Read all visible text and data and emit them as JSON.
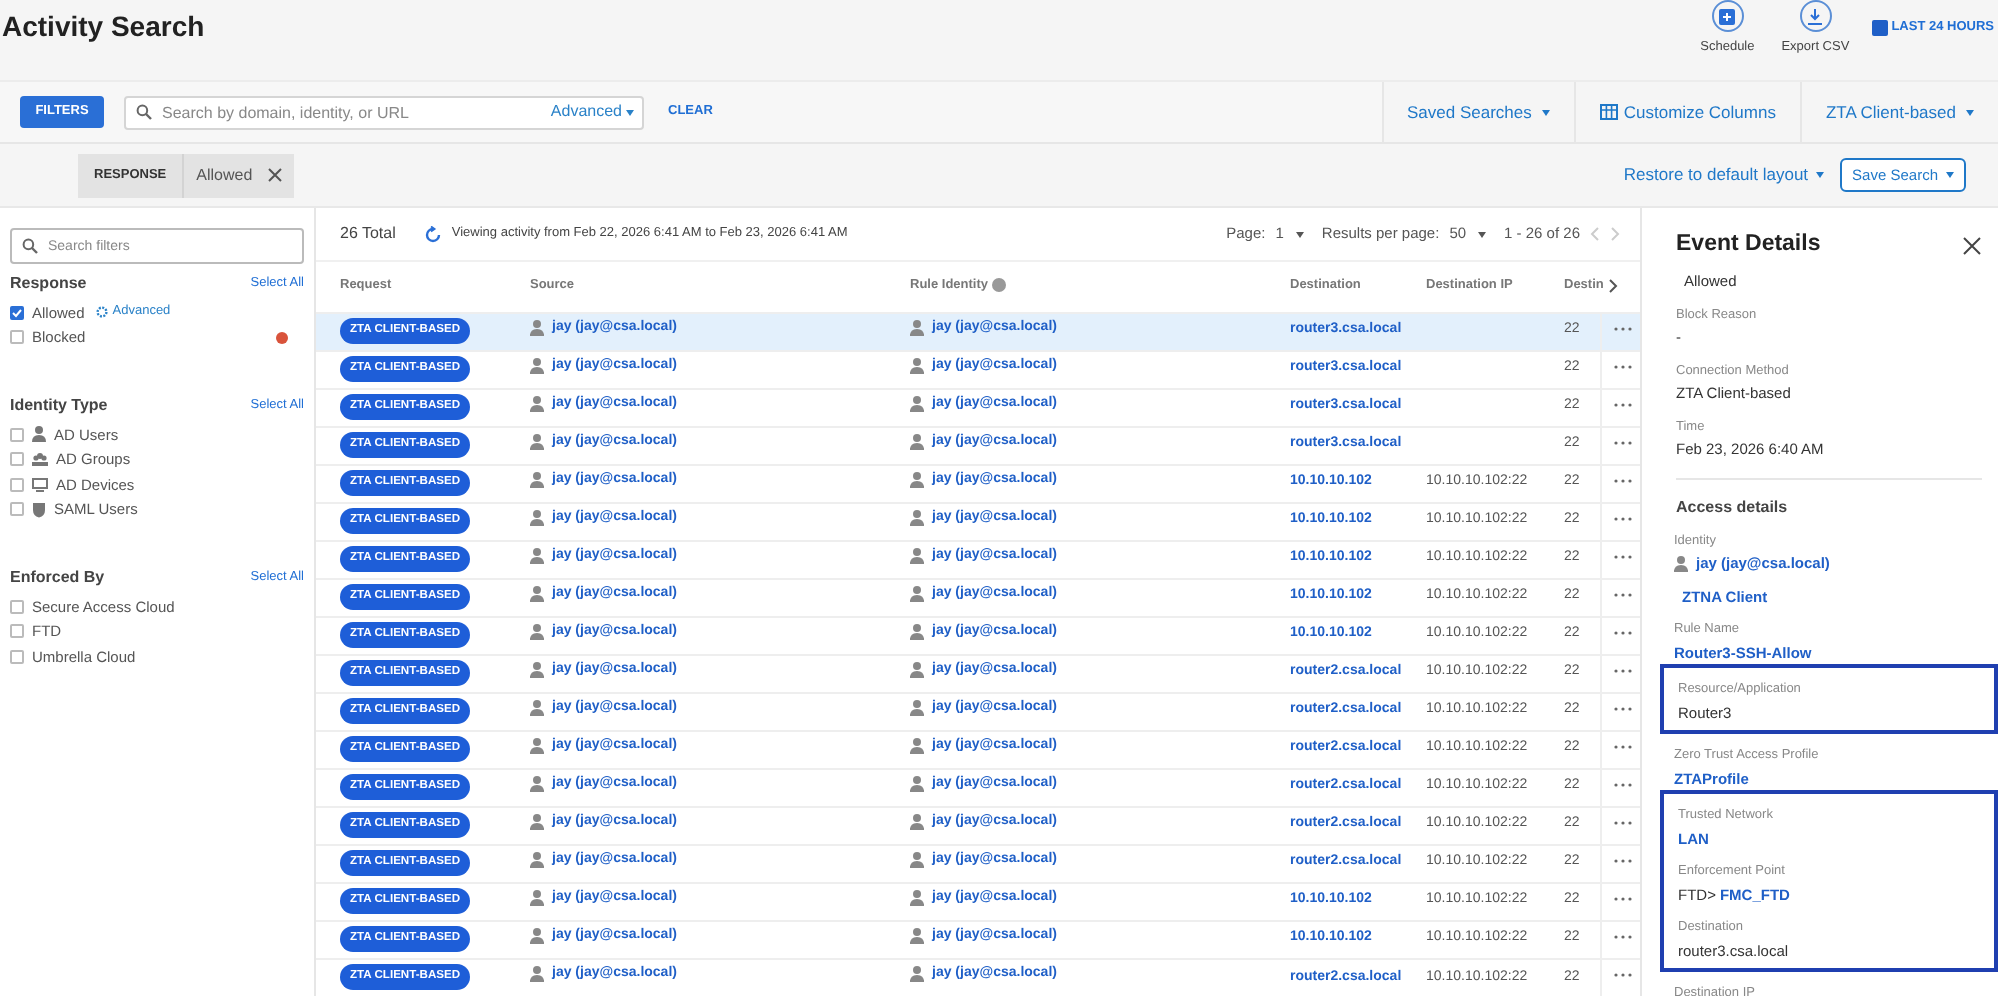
{
  "header": {
    "title": "Activity Search",
    "actions": [
      {
        "label": "Schedule",
        "kind": "schedule"
      },
      {
        "label": "Export CSV",
        "kind": "export"
      }
    ],
    "time_range": "LAST 24 HOURS"
  },
  "toolbar": {
    "filters_button": "FILTERS",
    "search": {
      "placeholder": "Search by domain, identity, or URL",
      "advanced": "Advanced"
    },
    "clear": "CLEAR",
    "right": [
      {
        "label": "Saved Searches",
        "kind": "dropdown"
      },
      {
        "label": "Customize Columns",
        "kind": "columns"
      },
      {
        "label": "ZTA Client-based",
        "kind": "dropdown"
      }
    ]
  },
  "chips": [
    {
      "key": "RESPONSE",
      "value": "Allowed"
    }
  ],
  "layout_actions": {
    "restore": "Restore to default layout",
    "save": "Save Search"
  },
  "sidebar": {
    "search_placeholder": "Search filters",
    "groups": [
      {
        "title": "Response",
        "select_all": "Select All",
        "items": [
          {
            "label": "Allowed",
            "checked": true,
            "link": "Advanced"
          },
          {
            "label": "Blocked",
            "checked": false,
            "color": "#d9533b"
          }
        ]
      },
      {
        "title": "Identity Type",
        "select_all": "Select All",
        "items": [
          {
            "label": "AD Users",
            "checked": false,
            "kind": "user"
          },
          {
            "label": "AD Groups",
            "checked": false,
            "kind": "group"
          },
          {
            "label": "AD Devices",
            "checked": false,
            "kind": "device"
          },
          {
            "label": "SAML Users",
            "checked": false,
            "kind": "saml"
          }
        ]
      },
      {
        "title": "Enforced By",
        "select_all": "Select All",
        "items": [
          {
            "label": "Secure Access Cloud",
            "checked": false
          },
          {
            "label": "FTD",
            "checked": false
          },
          {
            "label": "Umbrella Cloud",
            "checked": false
          }
        ]
      }
    ]
  },
  "table": {
    "total": "26 Total",
    "range_text": "Viewing activity from Feb 22, 2026 6:41 AM to Feb 23, 2026 6:41 AM",
    "page_label": "Page:",
    "page": "1",
    "per_page_label": "Results per page:",
    "per_page": "50",
    "count": "1 - 26 of 26",
    "columns": [
      "Request",
      "Source",
      "Rule Identity",
      "Destination",
      "Destination IP",
      "Destin"
    ],
    "rows": [
      {
        "selected": true,
        "request": "ZTA CLIENT-BASED",
        "source": "jay (jay@csa.local)",
        "rule_identity": "jay (jay@csa.local)",
        "destination": "router3.csa.local",
        "port": "22"
      },
      {
        "selected": false,
        "request": "ZTA CLIENT-BASED",
        "source": "jay (jay@csa.local)",
        "rule_identity": "jay (jay@csa.local)",
        "destination": "router3.csa.local",
        "port": "22"
      },
      {
        "selected": false,
        "request": "ZTA CLIENT-BASED",
        "source": "jay (jay@csa.local)",
        "rule_identity": "jay (jay@csa.local)",
        "destination": "router3.csa.local",
        "port": "22"
      },
      {
        "selected": false,
        "request": "ZTA CLIENT-BASED",
        "source": "jay (jay@csa.local)",
        "rule_identity": "jay (jay@csa.local)",
        "destination": "router3.csa.local",
        "port": "22"
      },
      {
        "selected": false,
        "request": "ZTA CLIENT-BASED",
        "source": "jay (jay@csa.local)",
        "rule_identity": "jay (jay@csa.local)",
        "destination": "10.10.10.102",
        "destination_ip": "10.10.10.102:22",
        "port": "22"
      },
      {
        "selected": false,
        "request": "ZTA CLIENT-BASED",
        "source": "jay (jay@csa.local)",
        "rule_identity": "jay (jay@csa.local)",
        "destination": "10.10.10.102",
        "destination_ip": "10.10.10.102:22",
        "port": "22"
      },
      {
        "selected": false,
        "request": "ZTA CLIENT-BASED",
        "source": "jay (jay@csa.local)",
        "rule_identity": "jay (jay@csa.local)",
        "destination": "10.10.10.102",
        "destination_ip": "10.10.10.102:22",
        "port": "22"
      },
      {
        "selected": false,
        "request": "ZTA CLIENT-BASED",
        "source": "jay (jay@csa.local)",
        "rule_identity": "jay (jay@csa.local)",
        "destination": "10.10.10.102",
        "destination_ip": "10.10.10.102:22",
        "port": "22"
      },
      {
        "selected": false,
        "request": "ZTA CLIENT-BASED",
        "source": "jay (jay@csa.local)",
        "rule_identity": "jay (jay@csa.local)",
        "destination": "10.10.10.102",
        "destination_ip": "10.10.10.102:22",
        "port": "22"
      },
      {
        "selected": false,
        "request": "ZTA CLIENT-BASED",
        "source": "jay (jay@csa.local)",
        "rule_identity": "jay (jay@csa.local)",
        "destination": "router2.csa.local",
        "destination_ip": "10.10.10.102:22",
        "port": "22"
      },
      {
        "selected": false,
        "request": "ZTA CLIENT-BASED",
        "source": "jay (jay@csa.local)",
        "rule_identity": "jay (jay@csa.local)",
        "destination": "router2.csa.local",
        "destination_ip": "10.10.10.102:22",
        "port": "22"
      },
      {
        "selected": false,
        "request": "ZTA CLIENT-BASED",
        "source": "jay (jay@csa.local)",
        "rule_identity": "jay (jay@csa.local)",
        "destination": "router2.csa.local",
        "destination_ip": "10.10.10.102:22",
        "port": "22"
      },
      {
        "selected": false,
        "request": "ZTA CLIENT-BASED",
        "source": "jay (jay@csa.local)",
        "rule_identity": "jay (jay@csa.local)",
        "destination": "router2.csa.local",
        "destination_ip": "10.10.10.102:22",
        "port": "22"
      },
      {
        "selected": false,
        "request": "ZTA CLIENT-BASED",
        "source": "jay (jay@csa.local)",
        "rule_identity": "jay (jay@csa.local)",
        "destination": "router2.csa.local",
        "destination_ip": "10.10.10.102:22",
        "port": "22"
      },
      {
        "selected": false,
        "request": "ZTA CLIENT-BASED",
        "source": "jay (jay@csa.local)",
        "rule_identity": "jay (jay@csa.local)",
        "destination": "router2.csa.local",
        "destination_ip": "10.10.10.102:22",
        "port": "22"
      },
      {
        "selected": false,
        "request": "ZTA CLIENT-BASED",
        "source": "jay (jay@csa.local)",
        "rule_identity": "jay (jay@csa.local)",
        "destination": "10.10.10.102",
        "destination_ip": "10.10.10.102:22",
        "port": "22"
      },
      {
        "selected": false,
        "request": "ZTA CLIENT-BASED",
        "source": "jay (jay@csa.local)",
        "rule_identity": "jay (jay@csa.local)",
        "destination": "10.10.10.102",
        "destination_ip": "10.10.10.102:22",
        "port": "22"
      },
      {
        "selected": false,
        "request": "ZTA CLIENT-BASED",
        "source": "jay (jay@csa.local)",
        "rule_identity": "jay (jay@csa.local)",
        "destination": "router2.csa.local",
        "destination_ip": "10.10.10.102:22",
        "port": "22"
      }
    ]
  },
  "details": {
    "title": "Event Details",
    "status": "Allowed",
    "fields": [
      {
        "label": "Block Reason",
        "value": "-"
      },
      {
        "label": "Connection Method",
        "value": "ZTA Client-based"
      },
      {
        "label": "Time",
        "value": "Feb 23, 2026 6:40 AM"
      }
    ],
    "access_title": "Access details",
    "access_groups": [
      {
        "outlined": false,
        "fields": [
          {
            "label": "Identity",
            "parts": [
              {
                "text": "jay (jay@csa.local)",
                "kind": "user"
              }
            ]
          },
          {
            "parts": [
              {
                "text": "ZTNA Client",
                "kind": "link"
              }
            ]
          },
          {
            "label": "Rule Name",
            "parts": [
              {
                "text": "Router3-SSH-Allow",
                "kind": "link"
              }
            ]
          }
        ]
      },
      {
        "outlined": true,
        "fields": [
          {
            "label": "Resource/Application",
            "parts": [
              {
                "text": "Router3",
                "kind": "text"
              }
            ]
          }
        ]
      },
      {
        "outlined": false,
        "fields": [
          {
            "label": "Zero Trust Access Profile",
            "parts": [
              {
                "text": "ZTAProfile",
                "kind": "link"
              }
            ]
          }
        ]
      },
      {
        "outlined": true,
        "fields": [
          {
            "label": "Trusted Network",
            "parts": [
              {
                "text": "LAN",
                "kind": "link"
              }
            ]
          },
          {
            "label": "Enforcement Point",
            "parts": [
              {
                "text": "FTD>",
                "kind": "text"
              },
              {
                "text": "FMC_FTD",
                "kind": "link"
              }
            ]
          },
          {
            "label": "Destination",
            "parts": [
              {
                "text": "router3.csa.local",
                "kind": "text"
              }
            ]
          }
        ]
      },
      {
        "outlined": false,
        "fields": [
          {
            "label": "Destination IP"
          }
        ]
      }
    ]
  }
}
